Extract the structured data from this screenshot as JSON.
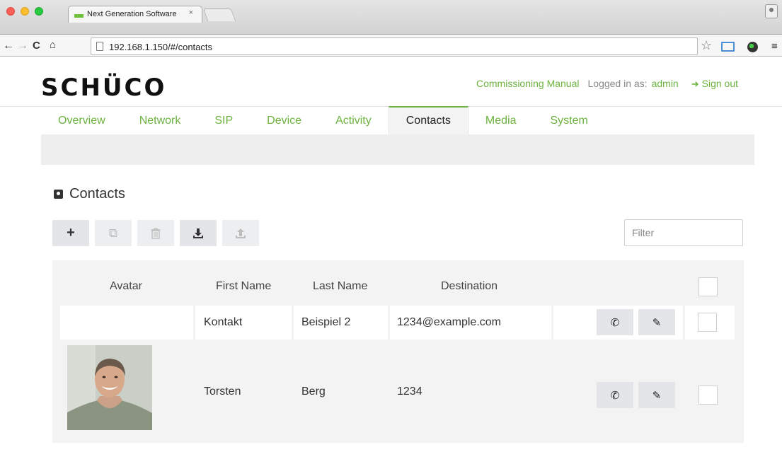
{
  "browser": {
    "tab_title": "Next Generation Software",
    "tab_close": "×",
    "url": "192.168.1.150/#/contacts"
  },
  "header": {
    "logo": "SCHÜCO",
    "commissioning_manual": "Commissioning Manual",
    "logged_in_label": "Logged in as:",
    "username": "admin",
    "sign_out": "Sign out"
  },
  "nav": {
    "tabs": [
      "Overview",
      "Network",
      "SIP",
      "Device",
      "Activity",
      "Contacts",
      "Media",
      "System"
    ],
    "active": "Contacts"
  },
  "section": {
    "title": "Contacts"
  },
  "filter": {
    "placeholder": "Filter"
  },
  "table": {
    "columns": [
      "Avatar",
      "First Name",
      "Last Name",
      "Destination"
    ],
    "rows": [
      {
        "first_name": "Kontakt",
        "last_name": "Beispiel 2",
        "destination": "1234@example.com",
        "has_avatar": false
      },
      {
        "first_name": "Torsten",
        "last_name": "Berg",
        "destination": "1234",
        "has_avatar": true
      }
    ]
  },
  "icons": {
    "add": "plus-icon",
    "copy": "copy-icon",
    "delete": "trash-icon",
    "import": "download-icon",
    "export": "upload-icon",
    "call": "phone-icon",
    "edit": "pencil-icon"
  },
  "colors": {
    "accent": "#6cb33f",
    "button_bg": "#e3e5e8",
    "table_bg": "#f3f3f3"
  }
}
